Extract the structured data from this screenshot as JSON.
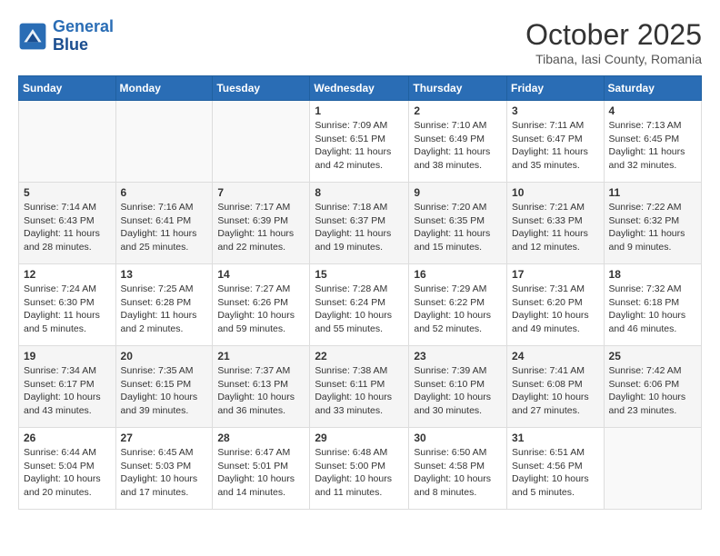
{
  "logo": {
    "line1": "General",
    "line2": "Blue"
  },
  "title": "October 2025",
  "subtitle": "Tibana, Iasi County, Romania",
  "weekdays": [
    "Sunday",
    "Monday",
    "Tuesday",
    "Wednesday",
    "Thursday",
    "Friday",
    "Saturday"
  ],
  "weeks": [
    [
      {
        "day": "",
        "info": ""
      },
      {
        "day": "",
        "info": ""
      },
      {
        "day": "",
        "info": ""
      },
      {
        "day": "1",
        "info": "Sunrise: 7:09 AM\nSunset: 6:51 PM\nDaylight: 11 hours\nand 42 minutes."
      },
      {
        "day": "2",
        "info": "Sunrise: 7:10 AM\nSunset: 6:49 PM\nDaylight: 11 hours\nand 38 minutes."
      },
      {
        "day": "3",
        "info": "Sunrise: 7:11 AM\nSunset: 6:47 PM\nDaylight: 11 hours\nand 35 minutes."
      },
      {
        "day": "4",
        "info": "Sunrise: 7:13 AM\nSunset: 6:45 PM\nDaylight: 11 hours\nand 32 minutes."
      }
    ],
    [
      {
        "day": "5",
        "info": "Sunrise: 7:14 AM\nSunset: 6:43 PM\nDaylight: 11 hours\nand 28 minutes."
      },
      {
        "day": "6",
        "info": "Sunrise: 7:16 AM\nSunset: 6:41 PM\nDaylight: 11 hours\nand 25 minutes."
      },
      {
        "day": "7",
        "info": "Sunrise: 7:17 AM\nSunset: 6:39 PM\nDaylight: 11 hours\nand 22 minutes."
      },
      {
        "day": "8",
        "info": "Sunrise: 7:18 AM\nSunset: 6:37 PM\nDaylight: 11 hours\nand 19 minutes."
      },
      {
        "day": "9",
        "info": "Sunrise: 7:20 AM\nSunset: 6:35 PM\nDaylight: 11 hours\nand 15 minutes."
      },
      {
        "day": "10",
        "info": "Sunrise: 7:21 AM\nSunset: 6:33 PM\nDaylight: 11 hours\nand 12 minutes."
      },
      {
        "day": "11",
        "info": "Sunrise: 7:22 AM\nSunset: 6:32 PM\nDaylight: 11 hours\nand 9 minutes."
      }
    ],
    [
      {
        "day": "12",
        "info": "Sunrise: 7:24 AM\nSunset: 6:30 PM\nDaylight: 11 hours\nand 5 minutes."
      },
      {
        "day": "13",
        "info": "Sunrise: 7:25 AM\nSunset: 6:28 PM\nDaylight: 11 hours\nand 2 minutes."
      },
      {
        "day": "14",
        "info": "Sunrise: 7:27 AM\nSunset: 6:26 PM\nDaylight: 10 hours\nand 59 minutes."
      },
      {
        "day": "15",
        "info": "Sunrise: 7:28 AM\nSunset: 6:24 PM\nDaylight: 10 hours\nand 55 minutes."
      },
      {
        "day": "16",
        "info": "Sunrise: 7:29 AM\nSunset: 6:22 PM\nDaylight: 10 hours\nand 52 minutes."
      },
      {
        "day": "17",
        "info": "Sunrise: 7:31 AM\nSunset: 6:20 PM\nDaylight: 10 hours\nand 49 minutes."
      },
      {
        "day": "18",
        "info": "Sunrise: 7:32 AM\nSunset: 6:18 PM\nDaylight: 10 hours\nand 46 minutes."
      }
    ],
    [
      {
        "day": "19",
        "info": "Sunrise: 7:34 AM\nSunset: 6:17 PM\nDaylight: 10 hours\nand 43 minutes."
      },
      {
        "day": "20",
        "info": "Sunrise: 7:35 AM\nSunset: 6:15 PM\nDaylight: 10 hours\nand 39 minutes."
      },
      {
        "day": "21",
        "info": "Sunrise: 7:37 AM\nSunset: 6:13 PM\nDaylight: 10 hours\nand 36 minutes."
      },
      {
        "day": "22",
        "info": "Sunrise: 7:38 AM\nSunset: 6:11 PM\nDaylight: 10 hours\nand 33 minutes."
      },
      {
        "day": "23",
        "info": "Sunrise: 7:39 AM\nSunset: 6:10 PM\nDaylight: 10 hours\nand 30 minutes."
      },
      {
        "day": "24",
        "info": "Sunrise: 7:41 AM\nSunset: 6:08 PM\nDaylight: 10 hours\nand 27 minutes."
      },
      {
        "day": "25",
        "info": "Sunrise: 7:42 AM\nSunset: 6:06 PM\nDaylight: 10 hours\nand 23 minutes."
      }
    ],
    [
      {
        "day": "26",
        "info": "Sunrise: 6:44 AM\nSunset: 5:04 PM\nDaylight: 10 hours\nand 20 minutes."
      },
      {
        "day": "27",
        "info": "Sunrise: 6:45 AM\nSunset: 5:03 PM\nDaylight: 10 hours\nand 17 minutes."
      },
      {
        "day": "28",
        "info": "Sunrise: 6:47 AM\nSunset: 5:01 PM\nDaylight: 10 hours\nand 14 minutes."
      },
      {
        "day": "29",
        "info": "Sunrise: 6:48 AM\nSunset: 5:00 PM\nDaylight: 10 hours\nand 11 minutes."
      },
      {
        "day": "30",
        "info": "Sunrise: 6:50 AM\nSunset: 4:58 PM\nDaylight: 10 hours\nand 8 minutes."
      },
      {
        "day": "31",
        "info": "Sunrise: 6:51 AM\nSunset: 4:56 PM\nDaylight: 10 hours\nand 5 minutes."
      },
      {
        "day": "",
        "info": ""
      }
    ]
  ]
}
